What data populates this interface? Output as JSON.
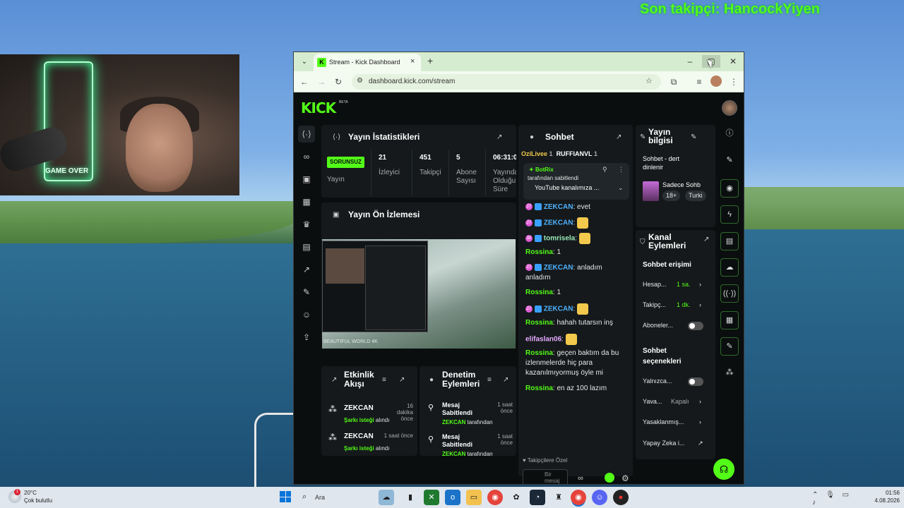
{
  "overlay": {
    "last_follower": "Son takipçi: HancockYiyen"
  },
  "webcam": {
    "neon_sign": "GAME OVER"
  },
  "browser": {
    "tab_title": "Stream - Kick Dashboard",
    "url": "dashboard.kick.com/stream",
    "close_glyph": "×",
    "new_tab_glyph": "+"
  },
  "dashboard": {
    "logo": "KICK",
    "logo_beta": "BETA",
    "stats": {
      "title": "Yayın İstatistikleri",
      "status_badge": "SORUNSUZ",
      "status_label": "Yayın",
      "items": [
        {
          "value": "21",
          "label": "İzleyici"
        },
        {
          "value": "451",
          "label": "Takipçi"
        },
        {
          "value": "5",
          "label": "Abone Sayısı"
        },
        {
          "value": "06:31:0",
          "label": "Yayında Olduğu Süre"
        }
      ]
    },
    "preview": {
      "title": "Yayın Ön İzlemesi",
      "caption": "BEAUTIFUL WORLD 4K"
    },
    "chat": {
      "title": "Sohbet",
      "top_users": [
        {
          "name": "OziLivee",
          "count": "1"
        },
        {
          "name": "RUFFIANVL",
          "count": "1"
        }
      ],
      "pinned": {
        "user": "BotRix",
        "by": "tarafından sabitlendi",
        "message": "YouTube kanalımıza ..."
      },
      "messages": [
        {
          "badge": "27",
          "user": "ZEKCAN",
          "text": ": evet",
          "style": "zekcan",
          "emote": false
        },
        {
          "badge": "27",
          "user": "ZEKCAN",
          "text": ":",
          "style": "zekcan",
          "emote": true
        },
        {
          "badge": "30",
          "user": "tomrisela",
          "text": ":",
          "style": "tomri",
          "emote": true
        },
        {
          "badge": "",
          "user": "Rossina",
          "text": ": 1",
          "style": "rossina",
          "emote": false
        },
        {
          "badge": "27",
          "user": "ZEKCAN",
          "text": ": anladım anladım",
          "style": "zekcan",
          "emote": false
        },
        {
          "badge": "",
          "user": "Rossina",
          "text": ": 1",
          "style": "rossina",
          "emote": false
        },
        {
          "badge": "27",
          "user": "ZEKCAN",
          "text": ":",
          "style": "zekcan",
          "emote": true
        },
        {
          "badge": "",
          "user": "Rossina",
          "text": ": hahah tutarsın inş",
          "style": "rossina",
          "emote": false
        },
        {
          "badge": "",
          "user": "elifaslan06",
          "text": ":",
          "style": "elif",
          "emote": true
        },
        {
          "badge": "",
          "user": "Rossina",
          "text": ": geçen baktım da bu izlenmelerde hiç para kazanılmıyormuş öyle mi",
          "style": "rossina",
          "emote": false
        },
        {
          "badge": "",
          "user": "Rossina",
          "text": ": en az 100 lazım",
          "style": "rossina",
          "emote": false
        }
      ],
      "followers_only": "Takipçilere Özel",
      "input_placeholder": "Bir mesaj gönderin"
    },
    "stream_info": {
      "title": "Yayın bilgisi",
      "stream_title": "Sohbet - dert dinlenir",
      "category": "Sadece Sohb",
      "tags": [
        "18+",
        "Turki"
      ]
    },
    "channel_actions": {
      "title": "Kanal Eylemleri",
      "chat_access_header": "Sohbet erişimi",
      "rows": [
        {
          "label": "Hesap...",
          "value": "1 sa."
        },
        {
          "label": "Takipç...",
          "value": "1 dk."
        }
      ],
      "subscribers_label": "Aboneler...",
      "chat_options_header": "Sohbet seçenekleri",
      "only_label": "Yalnızca...",
      "slow_label": "Yava...",
      "slow_value": "Kapalı",
      "banned_label": "Yasaklanmış...",
      "ai_label": "Yapay Zeka i..."
    },
    "activity": {
      "title": "Etkinlik Akışı",
      "items": [
        {
          "user": "ZEKCAN",
          "green": "Şarkı isteği",
          "rest": " alındı",
          "time": "16 dakika önce"
        },
        {
          "user": "ZEKCAN",
          "green": "Şarkı isteği",
          "rest": " alındı",
          "time": "1 saat önce"
        }
      ]
    },
    "moderation": {
      "title": "Denetim Eylemleri",
      "items": [
        {
          "action": "Mesaj Sabitlendi",
          "by_user": "ZEKCAN",
          "by_rest": " tarafından",
          "time": "1 saat önce"
        },
        {
          "action": "Mesaj Sabitlendi",
          "by_user": "ZEKCAN",
          "by_rest": " tarafından",
          "time": "1 saat önce"
        }
      ]
    }
  },
  "taskbar": {
    "temperature": "20°C",
    "weather": "Çok bulutlu",
    "weather_badge": "1",
    "search": "Ara",
    "time": "01:56",
    "date": "4.08.2026"
  },
  "colors": {
    "kick_green": "#53fc18",
    "chat_bg": "#15191b"
  }
}
